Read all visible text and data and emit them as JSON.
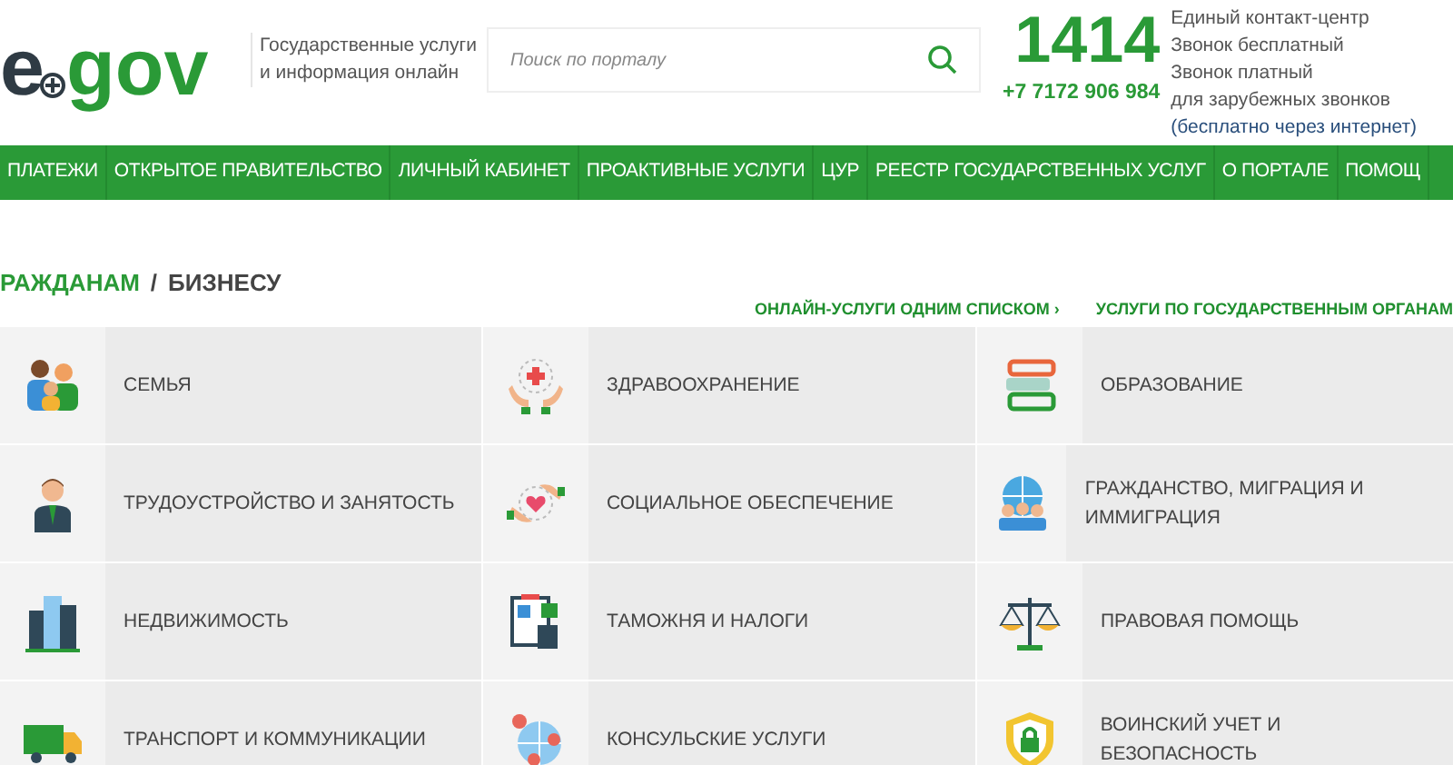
{
  "logo": {
    "left": "e",
    "right": "gov"
  },
  "tagline": "Государственные услуги и информация онлайн",
  "search": {
    "placeholder": "Поиск по порталу"
  },
  "contact": {
    "short_number": "1414",
    "phone": "+7 7172 906 984",
    "lines": [
      "Единый контакт-центр",
      "Звонок бесплатный",
      "Звонок платный",
      "для зарубежных звонков"
    ],
    "note": "(бесплатно через интернет)"
  },
  "nav": [
    "ПЛАТЕЖИ",
    "ОТКРЫТОЕ ПРАВИТЕЛЬСТВО",
    "ЛИЧНЫЙ КАБИНЕТ",
    "ПРОАКТИВНЫЕ УСЛУГИ",
    "ЦУР",
    "РЕЕСТР ГОСУДАРСТВЕННЫХ УСЛУГ",
    "О ПОРТАЛЕ",
    "ПОМОЩ"
  ],
  "audience_tabs": [
    {
      "label": "РАЖДАНАМ",
      "selected": true
    },
    {
      "label": "БИЗНЕСУ",
      "selected": false
    }
  ],
  "separator": "/",
  "links": [
    "ОНЛАЙН-УСЛУГИ ОДНИМ СПИСКОМ ›",
    "УСЛУГИ ПО ГОСУДАРСТВЕННЫМ ОРГАНАМ"
  ],
  "categories": [
    {
      "label": "СЕМЬЯ"
    },
    {
      "label": "ЗДРАВООХРАНЕНИЕ"
    },
    {
      "label": "ОБРАЗОВАНИЕ"
    },
    {
      "label": "ТРУДОУСТРОЙСТВО И ЗАНЯТОСТЬ"
    },
    {
      "label": "СОЦИАЛЬНОЕ ОБЕСПЕЧЕНИЕ"
    },
    {
      "label": "ГРАЖДАНСТВО, МИГРАЦИЯ И ИММИГРАЦИЯ"
    },
    {
      "label": "НЕДВИЖИМОСТЬ"
    },
    {
      "label": "ТАМОЖНЯ И НАЛОГИ"
    },
    {
      "label": "ПРАВОВАЯ ПОМОЩЬ"
    },
    {
      "label": "ТРАНСПОРТ И КОММУНИКАЦИИ"
    },
    {
      "label": "КОНСУЛЬСКИЕ УСЛУГИ"
    },
    {
      "label": "ВОИНСКИЙ УЧЕТ И БЕЗОПАСНОСТЬ"
    }
  ]
}
